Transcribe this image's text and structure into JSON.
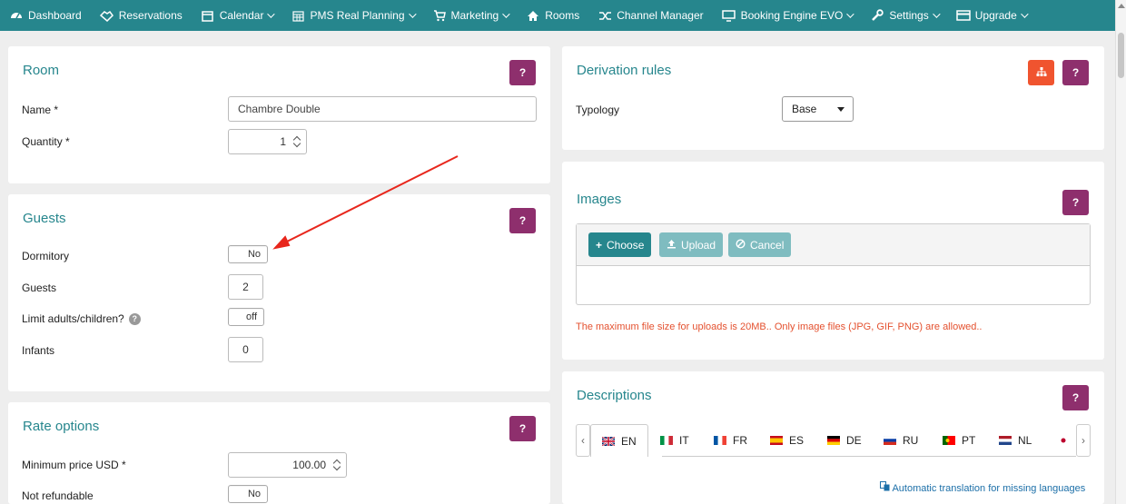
{
  "nav": {
    "items": [
      {
        "label": "Dashboard",
        "icon": "dashboard-icon",
        "dropdown": false
      },
      {
        "label": "Reservations",
        "icon": "handshake-icon",
        "dropdown": false
      },
      {
        "label": "Calendar",
        "icon": "calendar-icon",
        "dropdown": true
      },
      {
        "label": "PMS Real Planning",
        "icon": "calendar-grid-icon",
        "dropdown": true
      },
      {
        "label": "Marketing",
        "icon": "cart-icon",
        "dropdown": true
      },
      {
        "label": "Rooms",
        "icon": "home-icon",
        "dropdown": false
      },
      {
        "label": "Channel Manager",
        "icon": "shuffle-icon",
        "dropdown": false
      },
      {
        "label": "Booking Engine EVO",
        "icon": "monitor-icon",
        "dropdown": true
      },
      {
        "label": "Settings",
        "icon": "wrench-icon",
        "dropdown": true
      },
      {
        "label": "Upgrade",
        "icon": "credit-card-icon",
        "dropdown": true
      }
    ]
  },
  "room": {
    "title": "Room",
    "help": "?",
    "name_label": "Name *",
    "name_value": "Chambre Double",
    "quantity_label": "Quantity *",
    "quantity_value": "1"
  },
  "guests": {
    "title": "Guests",
    "help": "?",
    "dormitory_label": "Dormitory",
    "dormitory_value": "No",
    "guests_label": "Guests",
    "guests_value": "2",
    "limit_label": "Limit adults/children?",
    "limit_value": "off",
    "infants_label": "Infants",
    "infants_value": "0"
  },
  "rate": {
    "title": "Rate options",
    "help": "?",
    "min_price_label": "Minimum price USD *",
    "min_price_value": "100.00",
    "refundable_label": "Not refundable",
    "refundable_value": "No"
  },
  "derivation": {
    "title": "Derivation rules",
    "help": "?",
    "typology_label": "Typology",
    "typology_value": "Base"
  },
  "images": {
    "title": "Images",
    "help": "?",
    "choose_label": "Choose",
    "upload_label": "Upload",
    "cancel_label": "Cancel",
    "note": "The maximum file size for uploads is 20MB.. Only image files (JPG, GIF, PNG) are allowed.."
  },
  "descriptions": {
    "title": "Descriptions",
    "help": "?",
    "tabs": [
      "EN",
      "IT",
      "FR",
      "ES",
      "DE",
      "RU",
      "PT",
      "NL"
    ],
    "auto_translation": "Automatic translation for missing languages"
  },
  "colors": {
    "nav_bg": "#26868d",
    "title": "#26868d",
    "help_btn": "#8e2f6d",
    "tree_btn": "#f0542f",
    "choose_btn": "#26868d",
    "disabled_btn": "#7fbcc0",
    "note": "#e4512f",
    "annotation_arrow": "#e8261c"
  }
}
